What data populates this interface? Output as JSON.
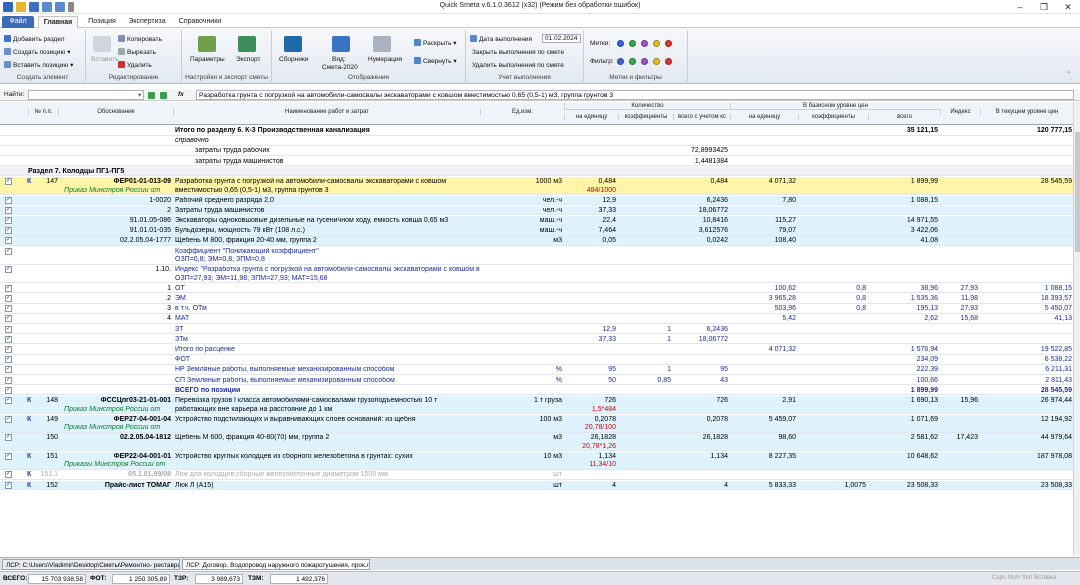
{
  "window": {
    "title": "Quick Smeta v.6.1.0.3612 (x32) (Режим без обработки ошибок)"
  },
  "tabs": [
    {
      "label": "Файл"
    },
    {
      "label": "Главная"
    },
    {
      "label": "Позиция"
    },
    {
      "label": "Экспертиза"
    },
    {
      "label": "Справочники"
    }
  ],
  "ribbon": {
    "element": {
      "add_section": "Добавить раздел",
      "create_position": "Создать позицию",
      "insert_position": "Вставить позицию",
      "label": "Создать элемент"
    },
    "edit": {
      "insert": "Вставить",
      "copy": "Копировать",
      "cut": "Вырезать",
      "delete": "Удалить",
      "label": "Редактирование"
    },
    "settings": {
      "params": "Параметры",
      "export": "Экспорт",
      "label": "Настройки и экспорт сметы"
    },
    "display": {
      "collections": "Сборники",
      "view": "Вид:",
      "view_value": "Смета-2020",
      "numbering": "Нумерация",
      "expand": "Раскрыть",
      "collapse": "Свернуть",
      "label": "Отображение"
    },
    "accounting": {
      "date_label": "Дата выполнения",
      "date_value": "01.02.2024",
      "close": "Закрыть выполнения по смете",
      "remove": "Удалить выполнения по смете",
      "label": "Учет выполнения"
    },
    "marks": {
      "marks": "Метки:",
      "filter": "Фильтр:",
      "label": "Метки и фильтры"
    }
  },
  "formula": {
    "find_label": "Найти:",
    "fx": "fx",
    "value": "Разработка грунта с погрузкой на автомобили-самосвалы экскаваторами с ковшом вместимостью 0,65 (0,5-1) м3, группа грунтов 3"
  },
  "header": {
    "num": "№ п.п.",
    "basis": "Обоснование",
    "name": "Наименование работ и затрат",
    "unit": "Ед.изм.",
    "qty": "Количество",
    "qty_unit": "на единицу",
    "qty_coef": "коэффициенты",
    "qty_total": "всего с учетом кс",
    "base": "В базисном уровне цен",
    "base_unit": "на единицу",
    "base_coef": "коэффициенты",
    "base_total": "всего",
    "index": "Индекс",
    "current": "В текущем уровне цен"
  },
  "rows": [
    {
      "name": "Итого по разделу 6. К-3 Производственная канализация",
      "base_total": "35 121,15",
      "current": "120 777,15",
      "bold": "y"
    },
    {
      "name": "справочно",
      "italic": "y"
    },
    {
      "name": "затраты труда рабочих",
      "qty_total": "72,8993425",
      "indent": "y"
    },
    {
      "name": "затраты труда машинистов",
      "qty_total": "1,4481384",
      "indent": "y"
    },
    {
      "section": "Раздел 7. Колодцы ПГ1-ПГ5"
    },
    {
      "num": "147",
      "basis": "ФЕР01-01-013-09",
      "basis2": "Приказ Минстроя России от",
      "name": "Разработка грунта с погрузкой на автомобили-самосвалы экскаваторами с ковшом",
      "name2": "вместимостью 0,65 (0,5-1) м3, группа грунтов 3",
      "unit": "1000 м3",
      "qty": "0,484",
      "qty2": "484/1000",
      "qty_total": "0,484",
      "base_unit": "4 071,32",
      "base_total": "1 899,99",
      "current": "28 545,59",
      "sel": "y",
      "k": "К"
    },
    {
      "basis": "1-0020",
      "name": "Рабочий среднего разряда 2,0",
      "unit": "чел.-ч",
      "qty": "12,9",
      "qty_total": "6,2436",
      "base_unit": "7,80",
      "base_total": "1 088,15",
      "pos": "y"
    },
    {
      "basis": "2",
      "name": "Затраты труда машинистов",
      "unit": "чел.-ч",
      "qty": "37,33",
      "qty_total": "18,06772",
      "pos": "y"
    },
    {
      "basis": "91.01.05-086",
      "name": "Экскаваторы одноковшовые дизельные на гусеничном ходу, емкость ковша 0,65 м3",
      "unit": "маш.-ч",
      "qty": "22,4",
      "qty_total": "10,8416",
      "base_unit": "115,27",
      "base_total": "14 971,55",
      "pos": "y"
    },
    {
      "basis": "91.01.01-035",
      "name": "Бульдозеры, мощность 79 кВт (108 л.с.)",
      "unit": "маш.-ч",
      "qty": "7,464",
      "qty_total": "3,612576",
      "base_unit": "79,07",
      "base_total": "3 422,06",
      "pos": "y"
    },
    {
      "basis": "02.2.05.04-1777",
      "name": "Щебень М 800, фракция 20-40 мм, группа 2",
      "unit": "м3",
      "qty": "0,05",
      "qty_total": "0,0242",
      "base_unit": "108,40",
      "base_total": "41,08",
      "pos": "y"
    },
    {
      "name": "Коэффициент \"Понижающий коэффициент\"",
      "name2": "ОЗП=0,8; ЭМ=0,8; ЗПМ=0,8",
      "blue": "y"
    },
    {
      "basis": "1.10.",
      "name": "Индекс \"Разработка грунта с погрузкой на автомобили-самосвалы экскаваторами с ковшом вместимостью 1; 0,65; 0,5 м3\"",
      "name2": "ОЗП=27,93; ЭМ=11,98; ЗПМ=27,93; МАТ=15,68",
      "blue": "y"
    },
    {
      "basis": "1",
      "name": "ОТ",
      "base_unit": "100,62",
      "base_coef": "0,8",
      "base_total": "38,96",
      "index": "27,93",
      "current": "1 088,15",
      "blue": "y"
    },
    {
      "basis": "2",
      "name": "ЭМ",
      "base_unit": "3 965,28",
      "base_coef": "0,8",
      "base_total": "1 535,36",
      "index": "11,98",
      "current": "18 393,57",
      "blue": "y"
    },
    {
      "basis": "3",
      "name": "в т.ч. ОТм",
      "base_unit": "503,96",
      "base_coef": "0,8",
      "base_total": "195,13",
      "index": "27,93",
      "current": "5 450,07",
      "blue": "y"
    },
    {
      "basis": "4",
      "name": "МАТ",
      "base_unit": "5,42",
      "base_total": "2,62",
      "index": "15,68",
      "current": "41,13",
      "blue": "y"
    },
    {
      "name": "ЗТ",
      "qty": "12,9",
      "qty_coef": "1",
      "qty_total": "6,2436",
      "blue": "y"
    },
    {
      "name": "ЗТм",
      "qty": "37,33",
      "qty_coef": "1",
      "qty_total": "18,06772",
      "blue": "y"
    },
    {
      "name": "Итого по расценке",
      "base_unit": "4 071,32",
      "base_total": "1 576,94",
      "current": "19 522,85",
      "blue": "y"
    },
    {
      "name": "ФОТ",
      "base_total": "234,09",
      "current": "6 538,22",
      "blue": "y"
    },
    {
      "name": "НР Земляные работы, выполняемые механизированным способом",
      "unit": "%",
      "qty": "95",
      "qty_coef": "1",
      "qty_total": "95",
      "base_total": "222,39",
      "current": "6 211,31",
      "blue": "y"
    },
    {
      "name": "СП Земляные работы, выполняемые механизированным способом",
      "unit": "%",
      "qty": "50",
      "qty_coef": "0,85",
      "qty_total": "43",
      "base_total": "100,66",
      "current": "2 811,43",
      "blue": "y"
    },
    {
      "name": "ВСЕГО по позиции",
      "base_total": "1 899,99",
      "current": "28 545,59",
      "blue": "y",
      "bold": "y"
    },
    {
      "num": "148",
      "basis": "ФССЦпг03-21-01-001",
      "basis2": "Приказ Минстроя России от",
      "name": "Перевозка грузов I класса автомобилями-самосвалами грузоподъемностью 10 т",
      "name2": "работающих вне карьера на расстояние до 1 км",
      "unit": "1 т груза",
      "qty": "726",
      "qty2": "1,5*484",
      "qty_total": "726",
      "base_unit": "2,91",
      "base_total": "1 690,13",
      "index": "15,96",
      "current": "26 974,44",
      "k": "К",
      "pos": "y"
    },
    {
      "num": "149",
      "basis": "ФЕР27-04-001-04",
      "basis2": "Приказ Минстроя России от",
      "name": "Устройство подстилающих и выравнивающих слоев оснований: из щебня",
      "unit": "100 м3",
      "qty": "0,2078",
      "qty2": "20,78/100",
      "qty_total": "0,2078",
      "base_unit": "5 459,07",
      "base_total": "1 071,69",
      "current": "12 194,92",
      "k": "К",
      "pos": "y"
    },
    {
      "num": "150",
      "basis": "02.2.05.04-1812",
      "name": "Щебень М 600, фракция 40-80(70) мм, группа 2",
      "unit": "м3",
      "qty": "26,1828",
      "qty2": "20,78*1,26",
      "qty_total": "26,1828",
      "base_unit": "98,60",
      "base_total": "2 581,62",
      "index": "17,423",
      "current": "44 979,64",
      "pos": "y"
    },
    {
      "num": "151",
      "basis": "ФЕР22-04-001-01",
      "basis2": "Приказы Минстроя России от",
      "name": "Устройство круглых колодцев из сборного железобетона в грунтах: сухих",
      "unit": "10 м3",
      "qty": "1,134",
      "qty2": "11,34/10",
      "qty_total": "1,134",
      "base_unit": "8 227,35",
      "base_total": "10 648,62",
      "current": "187 978,08",
      "k": "К",
      "pos": "y"
    },
    {
      "num": "151.1",
      "basis": "05.1.01.09/08",
      "name": "Люк для колодцев сборные железобетонные диаметром 1500 мм",
      "unit": "шт",
      "dim": "y",
      "k": "К"
    },
    {
      "num": "152",
      "basis": "Прайс-лист ТОМАГ",
      "name": "Люк Л (А15)",
      "unit": "шт",
      "qty": "4",
      "qty_total": "4",
      "base_unit": "5 833,33",
      "base_coef": "1,0075",
      "base_total": "23 508,33",
      "current": "23 508,33",
      "k": "К",
      "pos": "y"
    }
  ],
  "doctabs": [
    {
      "label": "ЛСР: C:\\Users\\Vladimir\\Desktop\\Сметы\\Ремонтно- реставра..."
    },
    {
      "label": "ЛСР: Договор. Водопровод наружного пожаротушения, прок.л..."
    }
  ],
  "status": {
    "total_label": "ВСЕГО:",
    "total": "15 703 938,58",
    "fot_label": "ФОТ:",
    "fot": "1 250 305,89",
    "tzr_label": "ТЗР:",
    "tzr": "3 989,673",
    "tzm_label": "ТЗМ:",
    "tzm": "1 492,376",
    "right": "Caps  Num  Scrl  Вставка"
  }
}
